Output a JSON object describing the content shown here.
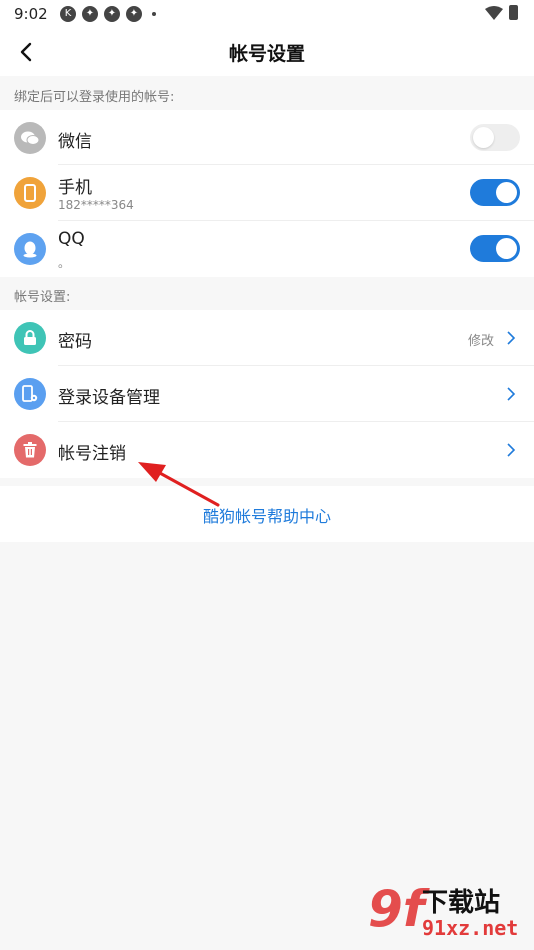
{
  "status_bar": {
    "time": "9:02",
    "icons": [
      "k-circle-icon",
      "pinwheel-icon",
      "pinwheel-icon",
      "pinwheel-icon"
    ],
    "right_icons": [
      "wifi-icon",
      "battery-icon"
    ]
  },
  "header": {
    "title": "帐号设置",
    "back_icon": "chevron-left-icon"
  },
  "bind_section": {
    "label": "绑定后可以登录使用的帐号:",
    "items": [
      {
        "title": "微信",
        "subtitle": "",
        "icon": "wechat-icon",
        "icon_color": "#b9b9b9",
        "enabled": false
      },
      {
        "title": "手机",
        "subtitle": "182*****364",
        "icon": "phone-icon",
        "icon_color": "#f0a33a",
        "enabled": true
      },
      {
        "title": "QQ",
        "subtitle": "。",
        "icon": "qq-icon",
        "icon_color": "#5ea2f0",
        "enabled": true
      }
    ]
  },
  "account_section": {
    "label": "帐号设置:",
    "items": [
      {
        "title": "密码",
        "action": "修改",
        "icon": "lock-icon",
        "icon_color": "#3fc4b6"
      },
      {
        "title": "登录设备管理",
        "action": "",
        "icon": "device-settings-icon",
        "icon_color": "#5a9ff0"
      },
      {
        "title": "帐号注销",
        "action": "",
        "icon": "trash-icon",
        "icon_color": "#e46a6a"
      }
    ]
  },
  "help": {
    "link": "酷狗帐号帮助中心"
  },
  "colors": {
    "accent": "#1f7bdb",
    "annotation_arrow": "#e02020"
  },
  "watermark": {
    "logo": "9f",
    "text": "下载站",
    "url": "91xz.net"
  }
}
